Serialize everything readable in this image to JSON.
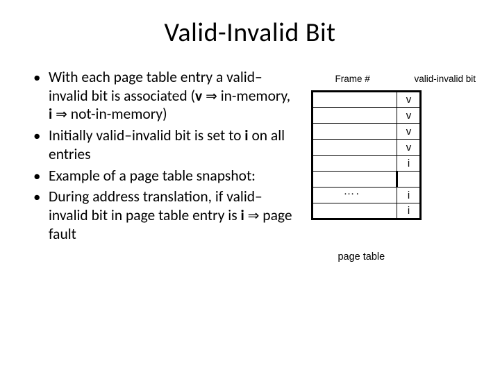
{
  "title": "Valid-Invalid Bit",
  "bullets": {
    "b1_a": "With each page table entry a valid–invalid bit is associated (",
    "b1_v": "v",
    "b1_b": " in-memory, ",
    "b1_i": "i",
    "b1_c": " not-in-memory)",
    "arrow": "⇒",
    "b2_a": "Initially valid–invalid bit is set to ",
    "b2_i": "i",
    "b2_b": " on all entries",
    "b3": "Example of a page table snapshot:",
    "b4_a": "During address translation, if valid–invalid bit in page table entry is ",
    "b4_i": "i",
    "b4_b": " page fault"
  },
  "figure": {
    "header_frame": "Frame #",
    "header_vib": "valid-invalid bit",
    "bits": [
      "v",
      "v",
      "v",
      "v",
      "i",
      "i",
      "i"
    ],
    "dots": "….",
    "caption": "page table"
  }
}
